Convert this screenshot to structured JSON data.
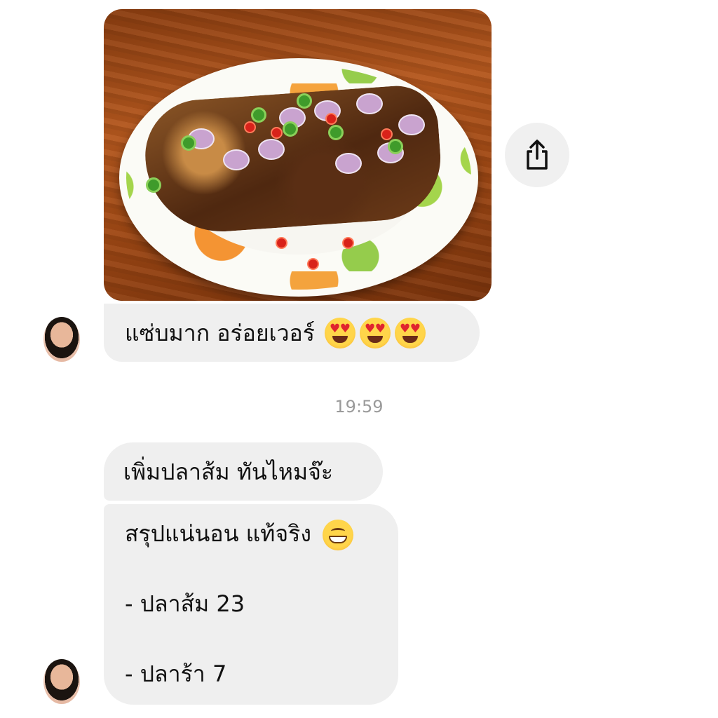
{
  "thread": {
    "message_1": {
      "text": "แซ่บมาก อร่อยเวอร์",
      "emoji": "smiling-face-with-heart-eyes"
    },
    "timestamp": "19:59",
    "message_2": {
      "text": "เพิ่มปลาส้ม ทันไหมจ๊ะ"
    },
    "message_3": {
      "line_1": "สรุปแน่นอน แท้จริง",
      "emoji": "beaming-face-with-smiling-eyes",
      "line_2": "- ปลาส้ม 23",
      "line_3": "- ปลาร้า 7"
    }
  },
  "icons": {
    "share": "share-icon"
  },
  "colors": {
    "bubble": "#efefef",
    "timestamp": "#9a9a9a",
    "share_button_bg": "#f0f0f0"
  }
}
